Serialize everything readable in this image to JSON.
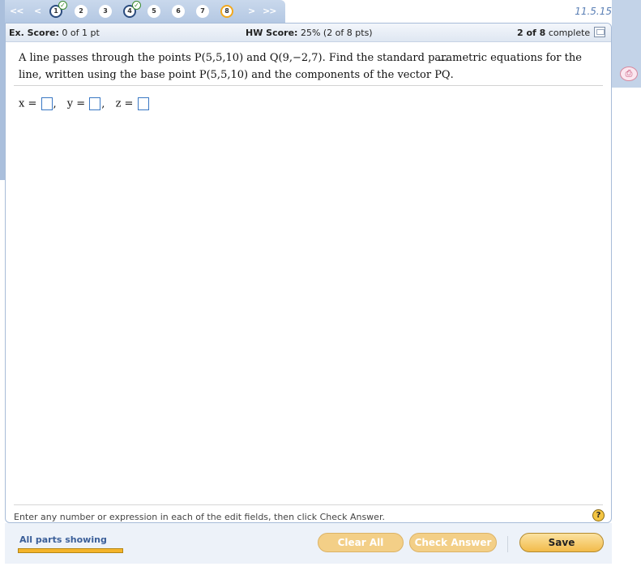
{
  "nav": {
    "first": "<<",
    "prev": "<",
    "next": ">",
    "last": ">>",
    "questions": [
      {
        "label": "1",
        "status": "done"
      },
      {
        "label": "2",
        "status": "open"
      },
      {
        "label": "3",
        "status": "open"
      },
      {
        "label": "4",
        "status": "done"
      },
      {
        "label": "5",
        "status": "open"
      },
      {
        "label": "6",
        "status": "open"
      },
      {
        "label": "7",
        "status": "open"
      },
      {
        "label": "8",
        "status": "current"
      }
    ],
    "check_glyph": "✓",
    "version": "11.5.15"
  },
  "score": {
    "ex_label": "Ex. Score:",
    "ex_value": "0 of 1 pt",
    "hw_label": "HW Score:",
    "hw_value": "25% (2 of 8 pts)",
    "complete_count": "2 of 8",
    "complete_word": "complete"
  },
  "question": {
    "part1": "A line passes through the points P(5,5,10) and Q(9,−2,7). Find the standard parametric equations for the line, written using the base point P(5,5,10) and the components of the vector ",
    "vector": "PQ",
    "vector_arrow": "⟶",
    "part2": "."
  },
  "answer": {
    "x_label": "x =",
    "y_label": "y =",
    "z_label": "z =",
    "sep": ","
  },
  "hint": "Enter any number or expression in each of the edit fields, then click Check Answer.",
  "help_glyph": "?",
  "footer": {
    "parts_label": "All parts showing",
    "clear": "Clear All",
    "check": "Check Answer",
    "save": "Save"
  },
  "side_tool_glyph": "⎙",
  "colors": {
    "nav_bg": "#b4c8e3",
    "accent_orange": "#f2a81d",
    "link_blue": "#3b5f99",
    "input_border": "#3a78c4"
  }
}
